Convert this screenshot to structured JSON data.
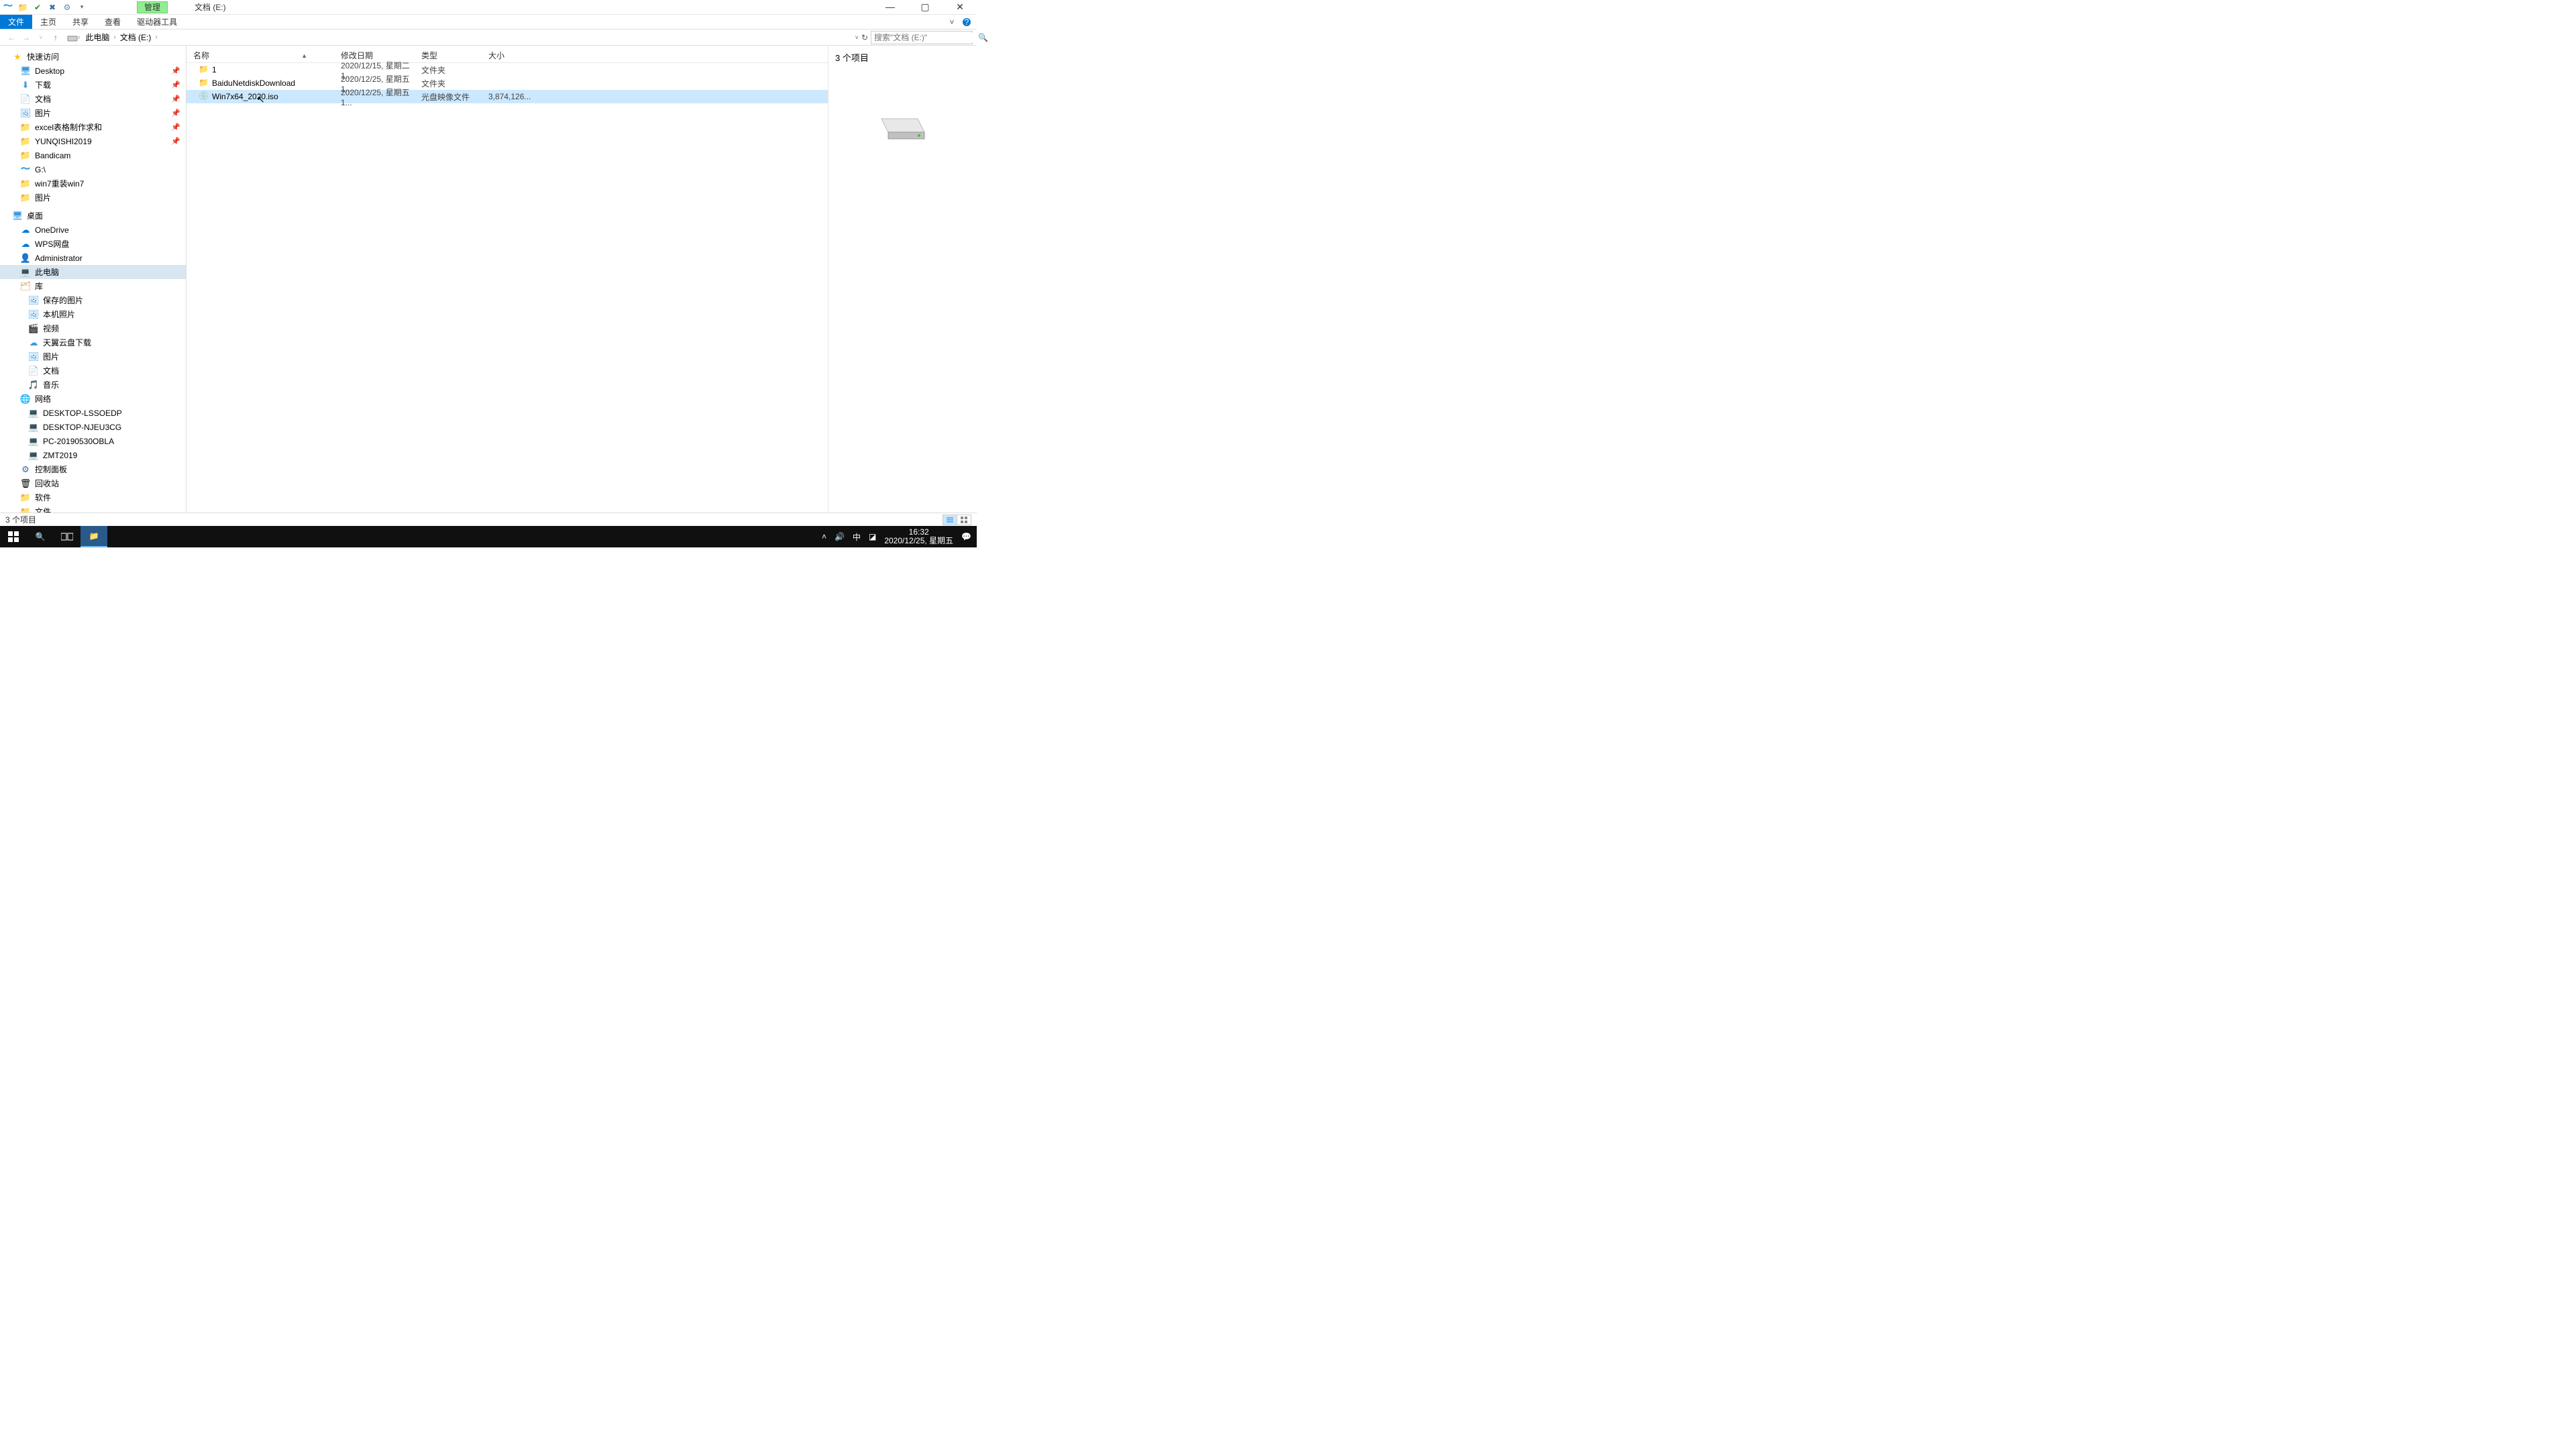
{
  "titlebar": {
    "context_tab": "管理",
    "title": "文档 (E:)"
  },
  "ribbon": {
    "file": "文件",
    "home": "主页",
    "share": "共享",
    "view": "查看",
    "drive_tools": "驱动器工具"
  },
  "addressbar": {
    "crumb1": "此电脑",
    "crumb2": "文档 (E:)",
    "search_placeholder": "搜索\"文档 (E:)\""
  },
  "columns": {
    "name": "名称",
    "date": "修改日期",
    "type": "类型",
    "size": "大小"
  },
  "files": {
    "r0": {
      "name": "1",
      "date": "2020/12/15, 星期二 1...",
      "type": "文件夹",
      "size": ""
    },
    "r1": {
      "name": "BaiduNetdiskDownload",
      "date": "2020/12/25, 星期五 1...",
      "type": "文件夹",
      "size": ""
    },
    "r2": {
      "name": "Win7x64_2020.iso",
      "date": "2020/12/25, 星期五 1...",
      "type": "光盘映像文件",
      "size": "3,874,126..."
    }
  },
  "sidebar": {
    "quick": "快速访问",
    "desktop": "Desktop",
    "downloads": "下载",
    "documents": "文档",
    "pictures": "图片",
    "excel": "excel表格制作求和",
    "yunqishi": "YUNQISHI2019",
    "bandicam": "Bandicam",
    "gdrive": "G:\\",
    "win7": "win7重装win7",
    "pictures2": "图片",
    "desktop_root": "桌面",
    "onedrive": "OneDrive",
    "wps": "WPS网盘",
    "admin": "Administrator",
    "thispc": "此电脑",
    "libraries": "库",
    "saved_pics": "保存的图片",
    "camera_roll": "本机照片",
    "videos": "视频",
    "tianyi": "天翼云盘下载",
    "lib_pictures": "图片",
    "lib_docs": "文档",
    "music": "音乐",
    "network": "网络",
    "net1": "DESKTOP-LSSOEDP",
    "net2": "DESKTOP-NJEU3CG",
    "net3": "PC-20190530OBLA",
    "net4": "ZMT2019",
    "control": "控制面板",
    "recycle": "回收站",
    "software": "软件",
    "files_folder": "文件"
  },
  "preview": {
    "item_count": "3 个项目"
  },
  "statusbar": {
    "count": "3 个项目"
  },
  "taskbar": {
    "time": "16:32",
    "date": "2020/12/25, 星期五",
    "ime": "中"
  }
}
